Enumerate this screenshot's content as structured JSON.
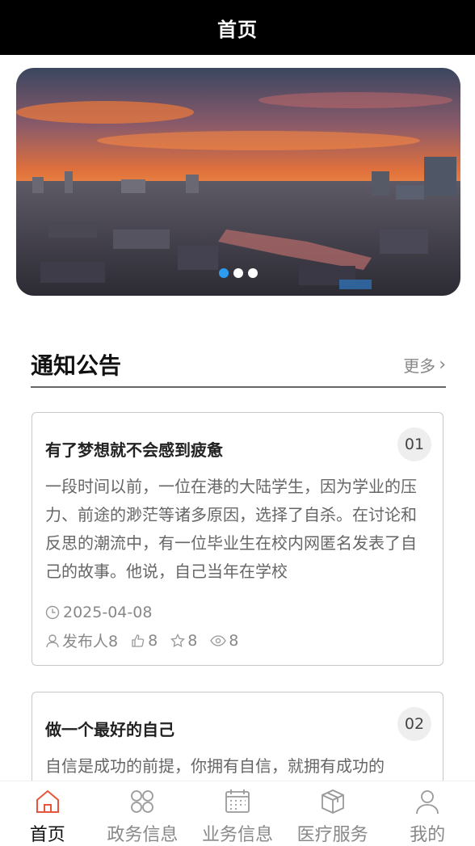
{
  "header": {
    "title": "首页"
  },
  "banner": {
    "slides": 3,
    "active_index": 0
  },
  "notices": {
    "title": "通知公告",
    "more_label": "更多",
    "items": [
      {
        "index": "01",
        "title": "有了梦想就不会感到疲惫",
        "body": "一段时间以前，一位在港的大陆学生，因为学业的压力、前途的渺茫等诸多原因，选择了自杀。在讨论和反思的潮流中，有一位毕业生在校内网匿名发表了自己的故事。他说，自己当年在学校",
        "date": "2025-04-08",
        "publisher": "发布人8",
        "likes": "8",
        "favorites": "8",
        "views": "8"
      },
      {
        "index": "02",
        "title": "做一个最好的自己",
        "body": "自信是成功的前提，你拥有自信，就拥有成功的"
      }
    ]
  },
  "tabbar": {
    "accent_color": "#e8553e",
    "items": [
      {
        "label": "首页",
        "icon": "home-icon",
        "active": true
      },
      {
        "label": "政务信息",
        "icon": "grid-circles-icon",
        "active": false
      },
      {
        "label": "业务信息",
        "icon": "calendar-icon",
        "active": false
      },
      {
        "label": "医疗服务",
        "icon": "box-icon",
        "active": false
      },
      {
        "label": "我的",
        "icon": "user-icon",
        "active": false
      }
    ]
  }
}
